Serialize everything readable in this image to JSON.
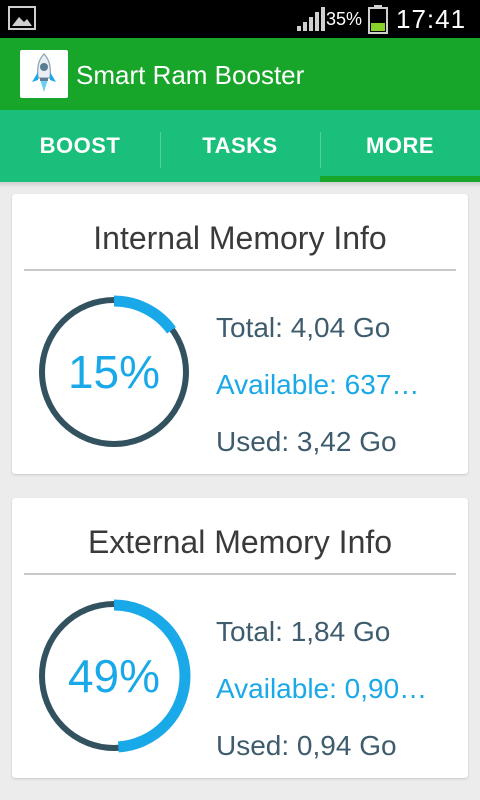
{
  "status_bar": {
    "battery_percent": "35%",
    "time": "17:41"
  },
  "app_bar": {
    "title": "Smart Ram Booster",
    "logo_icon": "rocket-icon"
  },
  "tabs": [
    {
      "label": "BOOST",
      "active": false
    },
    {
      "label": "TASKS",
      "active": false
    },
    {
      "label": "MORE",
      "active": true
    }
  ],
  "internal_memory": {
    "title": "Internal Memory Info",
    "percent_label": "15%",
    "percent_value": 15,
    "total": "Total: 4,04 Go",
    "available": "Available: 637…",
    "used": "Used: 3,42 Go"
  },
  "external_memory": {
    "title": "External Memory Info",
    "percent_label": "49%",
    "percent_value": 49,
    "total": "Total: 1,84 Go",
    "available": "Available: 0,90…",
    "used": "Used: 0,94 Go"
  },
  "colors": {
    "app_bar": "#17a52a",
    "tab_bar": "#19bf7a",
    "gauge_track": "#33525f",
    "gauge_fill": "#1aa9e8",
    "text_primary": "#3e5c6e",
    "text_accent": "#1aa9e8"
  }
}
